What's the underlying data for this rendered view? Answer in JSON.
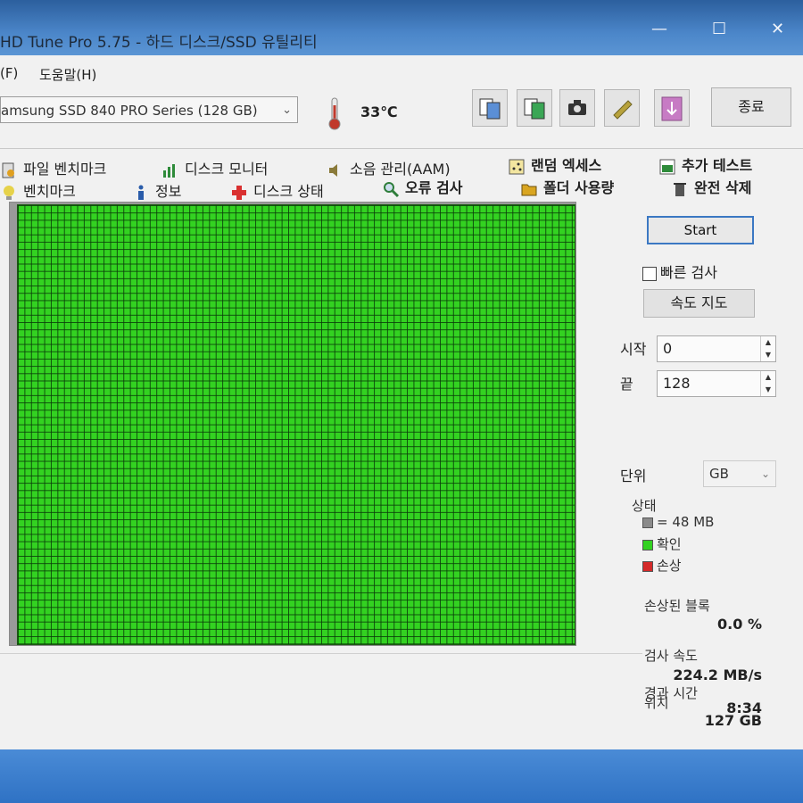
{
  "window": {
    "title": "HD Tune Pro 5.75 - 하드 디스크/SSD 유틸리티",
    "minimize_glyph": "—",
    "maximize_glyph": "☐",
    "close_glyph": "✕"
  },
  "menu": {
    "items": [
      "(F)",
      "도움말(H)"
    ]
  },
  "toolbar": {
    "drive": "amsung SSD 840 PRO Series (128 GB)",
    "temperature": "33℃",
    "buttons": [
      "copy-info-icon",
      "copy-screenshot-icon",
      "camera-icon",
      "options-icon",
      "save-icon"
    ],
    "exit_label": "종료"
  },
  "tabs": {
    "row1": [
      "파일 벤치마크",
      "디스크 모니터",
      "소음 관리(AAM)",
      "랜덤 엑세스",
      "추가 테스트"
    ],
    "row2": [
      "벤치마크",
      "정보",
      "디스크 상태",
      "오류 검사",
      "폴더 사용량",
      "완전 삭제"
    ]
  },
  "error_scan": {
    "start_label": "Start",
    "quick_check_label": "빠른 검사",
    "speed_map_label": "속도 지도",
    "start_field_label": "시작",
    "start_value": "0",
    "end_field_label": "끝",
    "end_value": "128",
    "unit_label": "단위",
    "unit_value": "GB",
    "legend": {
      "title": "상태",
      "block_size": "= 48 MB",
      "ok": "확인",
      "damaged": "손상"
    },
    "stats": {
      "damaged_blocks_label": "손상된 블록",
      "damaged_blocks_value": "0.0 %",
      "scan_speed_label": "검사 속도",
      "scan_speed_value": "224.2 MB/s",
      "position_label": "위치",
      "position_value": "127 GB",
      "elapsed_label": "경과 시간",
      "elapsed_value": "8:34"
    }
  },
  "colors": {
    "block_ok": "#33d221",
    "block_damaged": "#d42a2a",
    "block_size_swatch": "#8a8a8a",
    "accent": "#3b78c3"
  }
}
